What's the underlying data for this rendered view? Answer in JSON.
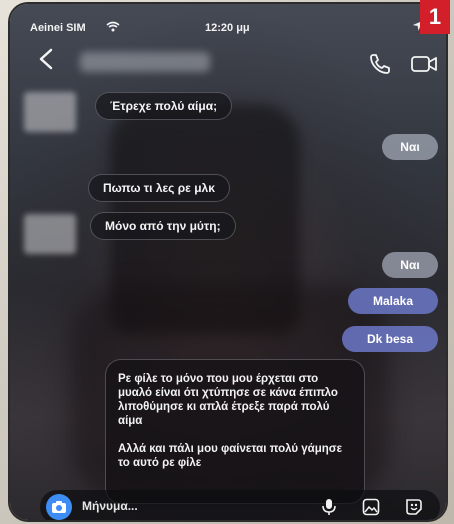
{
  "badge": "1",
  "status_bar": {
    "carrier": "Aeinei SIM",
    "time": "12:20 μμ",
    "wifi_icon": "wifi-icon",
    "location_icon": "location-arrow-icon"
  },
  "header": {
    "back_icon": "chevron-left-icon",
    "contact_name": "",
    "call_icon": "phone-icon",
    "video_icon": "video-camera-icon"
  },
  "messages": [
    {
      "side": "in",
      "text": "Έτρεχε πολύ αίμα;"
    },
    {
      "side": "out",
      "text": "Ναι"
    },
    {
      "side": "in",
      "text": "Πωπω τι λες ρε μλκ"
    },
    {
      "side": "in",
      "text": "Μόνο από την μύτη;"
    },
    {
      "side": "out",
      "text": "Ναι"
    },
    {
      "side": "out",
      "text": "Malaka"
    },
    {
      "side": "out",
      "text": "Dk besa"
    }
  ],
  "long_message": {
    "paragraph1": "Ρε φίλε το μόνο που μου έρχεται στο μυαλό είναι ότι χτύπησε σε κάνα έπιπλο λιποθύμησε κι απλά έτρεξε παρά πολύ αίμα",
    "paragraph2": "Αλλά και πάλι μου φαίνεται πολύ γάμησε το αυτό ρε φίλε"
  },
  "composer": {
    "placeholder": "Μήνυμα...",
    "camera_icon": "camera-icon",
    "mic_icon": "microphone-icon",
    "gallery_icon": "image-icon",
    "sticker_icon": "sticker-icon"
  },
  "colors": {
    "accent_blue": "#3d8df5",
    "outgoing_bubble": "#6c78c8",
    "badge_red": "#d21f2a"
  }
}
